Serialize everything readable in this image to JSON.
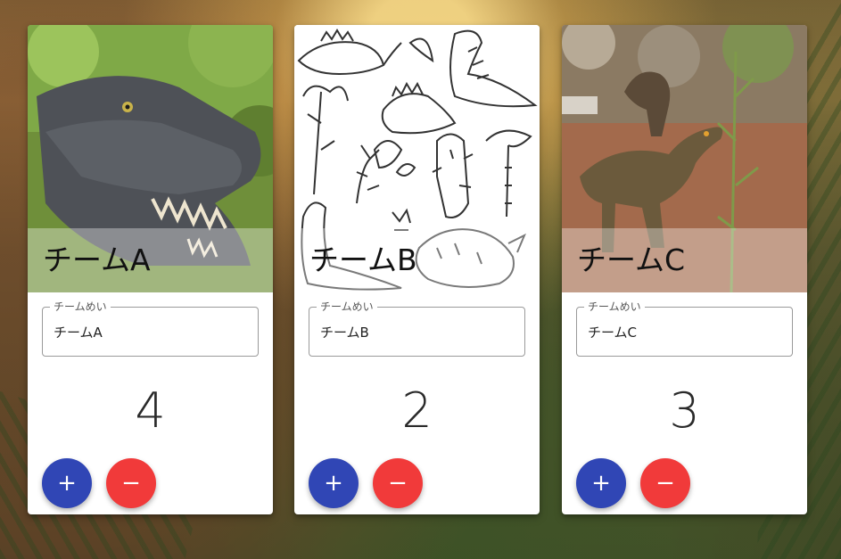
{
  "colors": {
    "plus_button": "#3046b5",
    "minus_button": "#f13a3a",
    "card_background": "#ffffff"
  },
  "teams": [
    {
      "title": "チームA",
      "field_label": "チームめい",
      "field_value": "チームA",
      "count": "4",
      "plus_label": "+",
      "minus_label": "−",
      "image": "t-rex-photo"
    },
    {
      "title": "チームB",
      "field_label": "チームめい",
      "field_value": "チームB",
      "count": "2",
      "plus_label": "+",
      "minus_label": "−",
      "image": "dinosaur-doodles"
    },
    {
      "title": "チームC",
      "field_label": "チームめい",
      "field_value": "チームC",
      "count": "3",
      "plus_label": "+",
      "minus_label": "−",
      "image": "raptor-photo"
    }
  ]
}
